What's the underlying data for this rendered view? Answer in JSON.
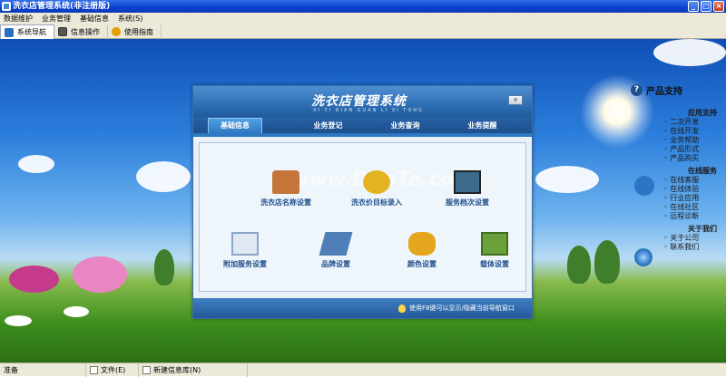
{
  "window": {
    "title": "洗衣店管理系统(非注册版)",
    "controls": [
      "_",
      "□",
      "×"
    ]
  },
  "menu": [
    "数据维护",
    "业务管理",
    "基础信息",
    "系统(S)"
  ],
  "toolbar": {
    "tabs": [
      {
        "label": "系统导航",
        "icon": "monitor-icon",
        "color": "#2a6fc0"
      },
      {
        "label": "信息操作",
        "icon": "window-icon",
        "color": "#555555"
      },
      {
        "label": "使用指南",
        "icon": "help-icon",
        "color": "#e0a000"
      }
    ]
  },
  "panel": {
    "title": "洗衣店管理系统",
    "subtitle": "XI YI DIAN GUAN LI XI TONG",
    "close": "×",
    "tabs": [
      "基础信息",
      "业务登记",
      "业务查询",
      "业务提醒"
    ],
    "items_row1": [
      {
        "label": "洗衣店名称设置",
        "icon": "house-icon",
        "color": "#c4763a"
      },
      {
        "label": "洗衣价目标录入",
        "icon": "coins-icon",
        "color": "#e3b322"
      },
      {
        "label": "服务档次设置",
        "icon": "monitor-icon",
        "color": "#3c6a8a"
      }
    ],
    "items_row2": [
      {
        "label": "附加服务设置",
        "icon": "document-icon",
        "color": "#8aa6c8"
      },
      {
        "label": "品牌设置",
        "icon": "pen-icon",
        "color": "#4f7fb8"
      },
      {
        "label": "颜色设置",
        "icon": "coin-stack-icon",
        "color": "#e3a61c"
      },
      {
        "label": "载体设置",
        "icon": "box-icon",
        "color": "#6aa13a"
      }
    ],
    "watermark": "www.DuoTe.com",
    "footer": "使用F8键可以显示/隐藏当前导航窗口"
  },
  "side": {
    "title": "产品支持",
    "sections": [
      {
        "title": "应用支持",
        "links": [
          "二次开发",
          "在线开发",
          "业务帮助",
          "产品形式",
          "产品购买"
        ]
      },
      {
        "title": "在线服务",
        "links": [
          "在线客服",
          "在线体验",
          "行业应用",
          "在线社区",
          "远程诊断"
        ]
      },
      {
        "title": "关于我们",
        "links": [
          "关于公司",
          "联系我们"
        ]
      }
    ]
  },
  "status": {
    "ready": "准备",
    "file": "文件(E)",
    "newlib": "新建信息库(N)"
  },
  "colors": {
    "title_bar": "#0a3fcf",
    "panel_header": "#2e6fb4",
    "item_text": "#1e4f8c"
  }
}
